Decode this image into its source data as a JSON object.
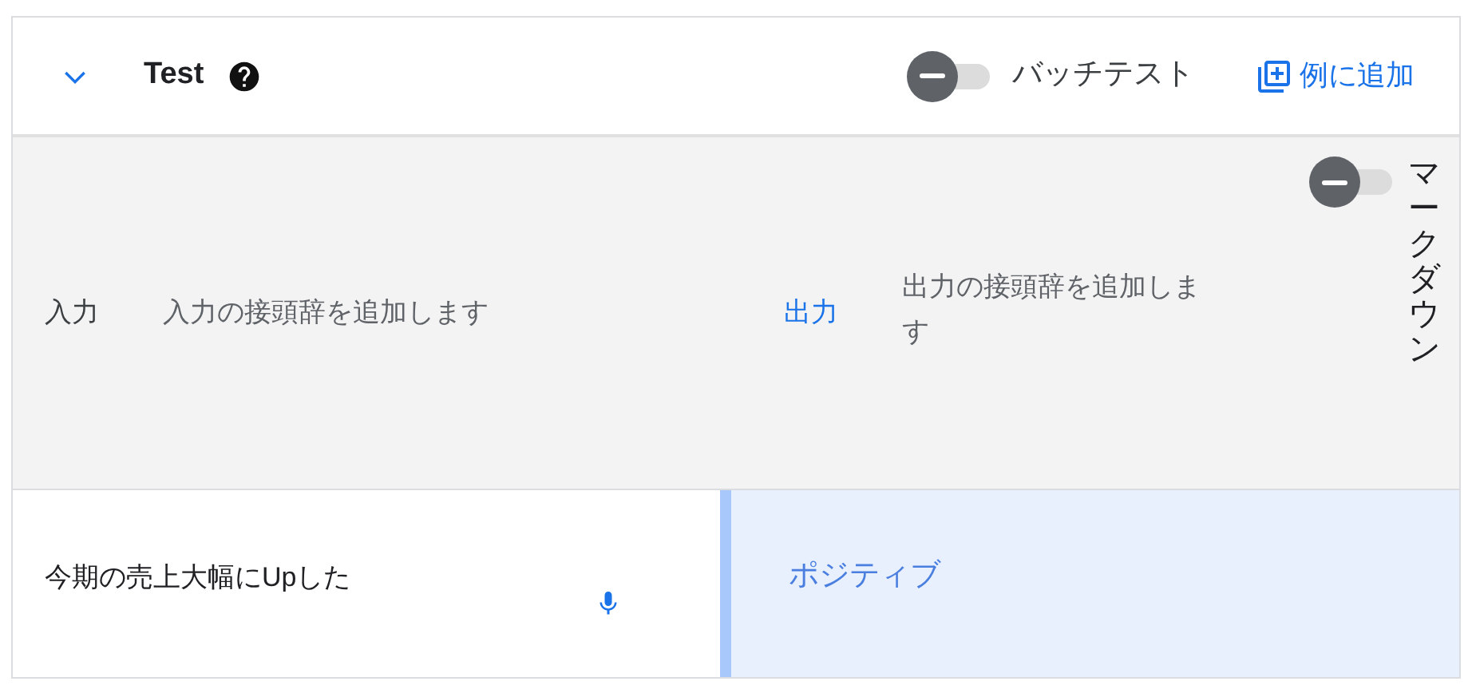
{
  "header": {
    "expanded": true,
    "title": "Test",
    "batch_test": {
      "label": "バッチテスト",
      "on": false
    },
    "add_example": {
      "label": "例に追加"
    }
  },
  "prefix_row": {
    "input_label": "入力",
    "input_placeholder": "入力の接頭辞を追加します",
    "output_label": "出力",
    "output_placeholder": "出力の接頭辞を追加します",
    "markdown": {
      "label": "マークダウン",
      "on": false
    }
  },
  "example": {
    "input": "今期の売上大幅にUpした",
    "output": "ポジティブ"
  }
}
